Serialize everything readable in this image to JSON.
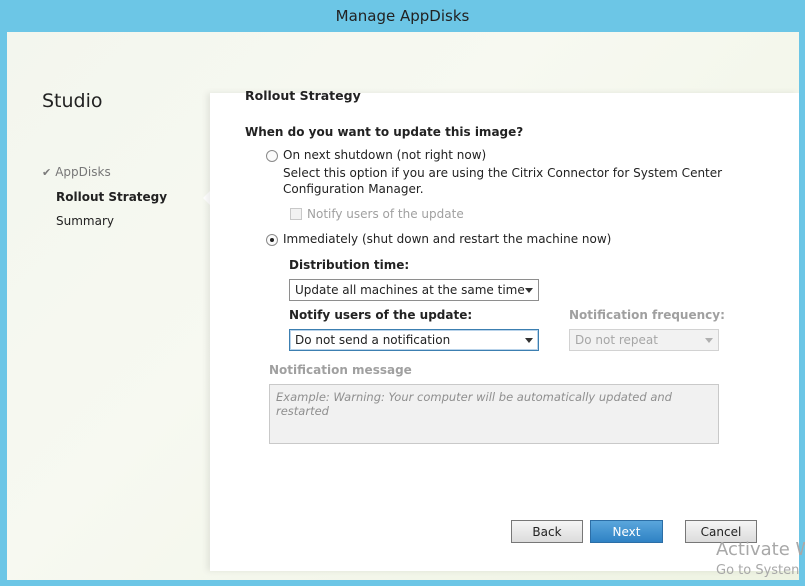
{
  "window": {
    "title": "Manage AppDisks"
  },
  "sidebar": {
    "title": "Studio",
    "items": [
      {
        "label": "AppDisks",
        "state": "done"
      },
      {
        "label": "Rollout Strategy",
        "state": "current"
      },
      {
        "label": "Summary",
        "state": "pending"
      }
    ]
  },
  "main": {
    "heading": "Rollout Strategy",
    "question": "When do you want to update this image?",
    "option_shutdown": {
      "label": "On next shutdown (not right now)",
      "selected": false,
      "description_line1": "Select this option if you are using the Citrix Connector for System Center",
      "description_line2": "Configuration Manager.",
      "notify_checkbox_label": "Notify users of the update",
      "notify_checked": false
    },
    "option_immediately": {
      "label": "Immediately (shut down and restart the machine now)",
      "selected": true
    },
    "distribution_time": {
      "label": "Distribution time:",
      "value": "Update all machines at the same time"
    },
    "notify_users": {
      "label": "Notify users of the update:",
      "value": "Do not send a notification"
    },
    "notification_frequency": {
      "label": "Notification frequency:",
      "value": "Do not repeat",
      "enabled": false
    },
    "notification_message": {
      "label": "Notification message",
      "placeholder": "Example:  Warning: Your computer will be automatically updated and restarted"
    }
  },
  "footer": {
    "back_label": "Back",
    "next_label": "Next",
    "cancel_label": "Cancel"
  },
  "watermark": {
    "line1": "Activate W",
    "line2": "Go to Systen"
  },
  "colors": {
    "titlebar": "#6cc6e6",
    "primary_button": "#2f82c4"
  }
}
